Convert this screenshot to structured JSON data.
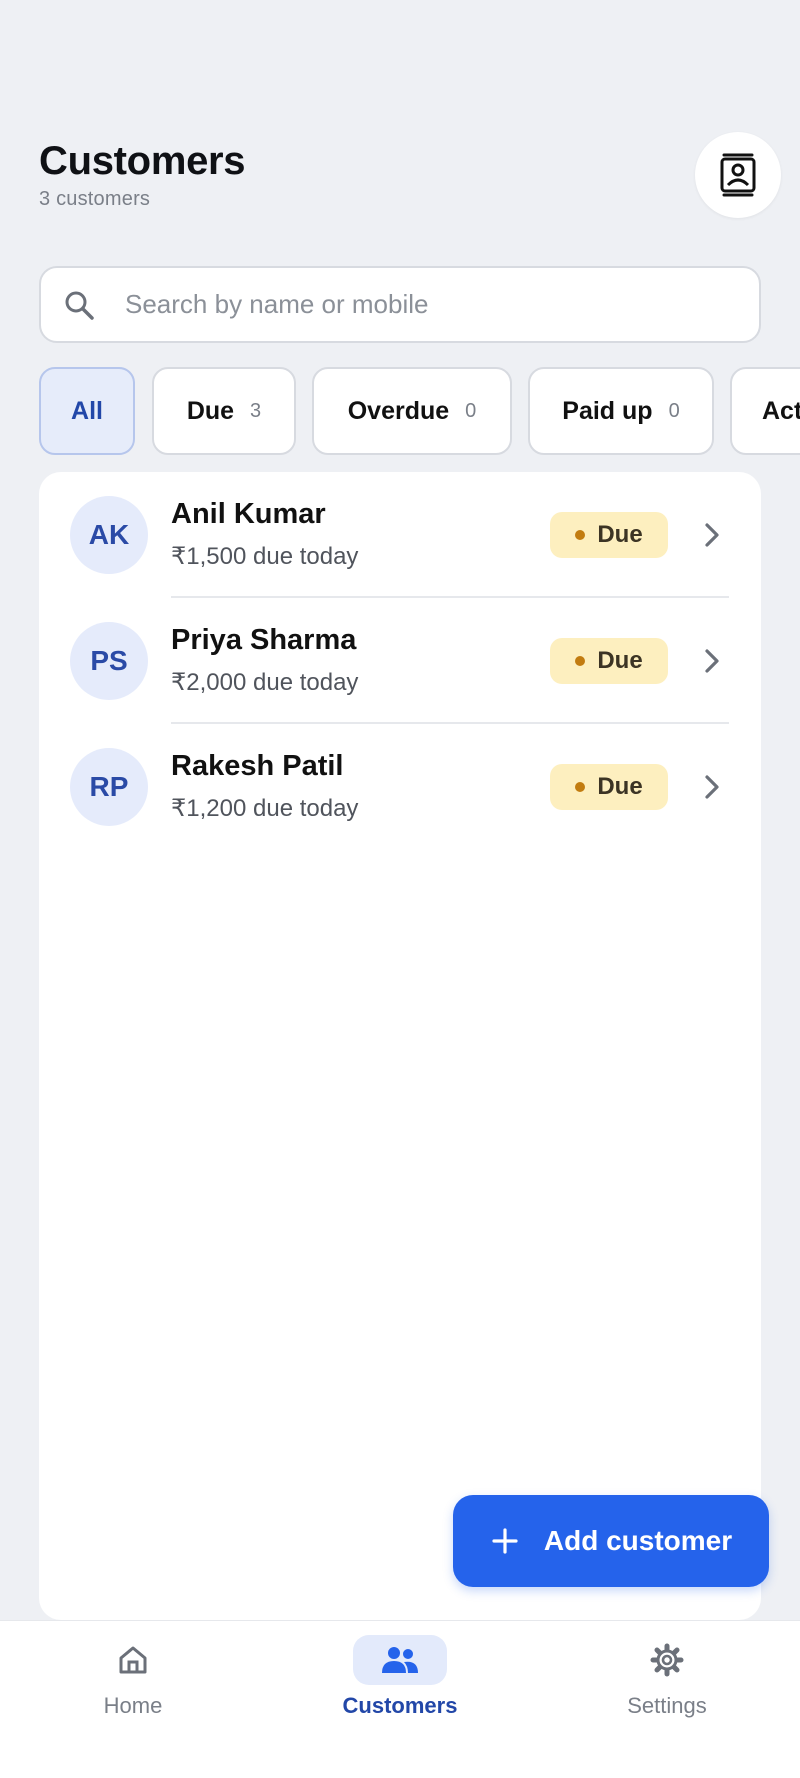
{
  "header": {
    "title": "Customers",
    "subtitle": "3 customers"
  },
  "search": {
    "placeholder": "Search by name or mobile",
    "value": ""
  },
  "filters": [
    {
      "label": "All",
      "count": "",
      "active": true
    },
    {
      "label": "Due",
      "count": "3",
      "active": false
    },
    {
      "label": "Overdue",
      "count": "0",
      "active": false
    },
    {
      "label": "Paid up",
      "count": "0",
      "active": false
    },
    {
      "label": "Act",
      "count": "",
      "active": false
    }
  ],
  "customers": [
    {
      "initials": "AK",
      "name": "Anil Kumar",
      "due": "₹1,500 due today",
      "status": "Due"
    },
    {
      "initials": "PS",
      "name": "Priya Sharma",
      "due": "₹2,000 due today",
      "status": "Due"
    },
    {
      "initials": "RP",
      "name": "Rakesh Patil",
      "due": "₹1,200 due today",
      "status": "Due"
    }
  ],
  "fab": {
    "label": "Add customer",
    "icon": "plus-icon"
  },
  "nav": [
    {
      "label": "Home",
      "icon": "home-icon",
      "active": false
    },
    {
      "label": "Customers",
      "icon": "people-icon",
      "active": true
    },
    {
      "label": "Settings",
      "icon": "gear-icon",
      "active": false
    }
  ],
  "colors": {
    "accent": "#2563eb",
    "active_text": "#2247a8",
    "due_badge_bg": "#fdefbf",
    "due_dot": "#c27c10",
    "background": "#eef0f4"
  }
}
